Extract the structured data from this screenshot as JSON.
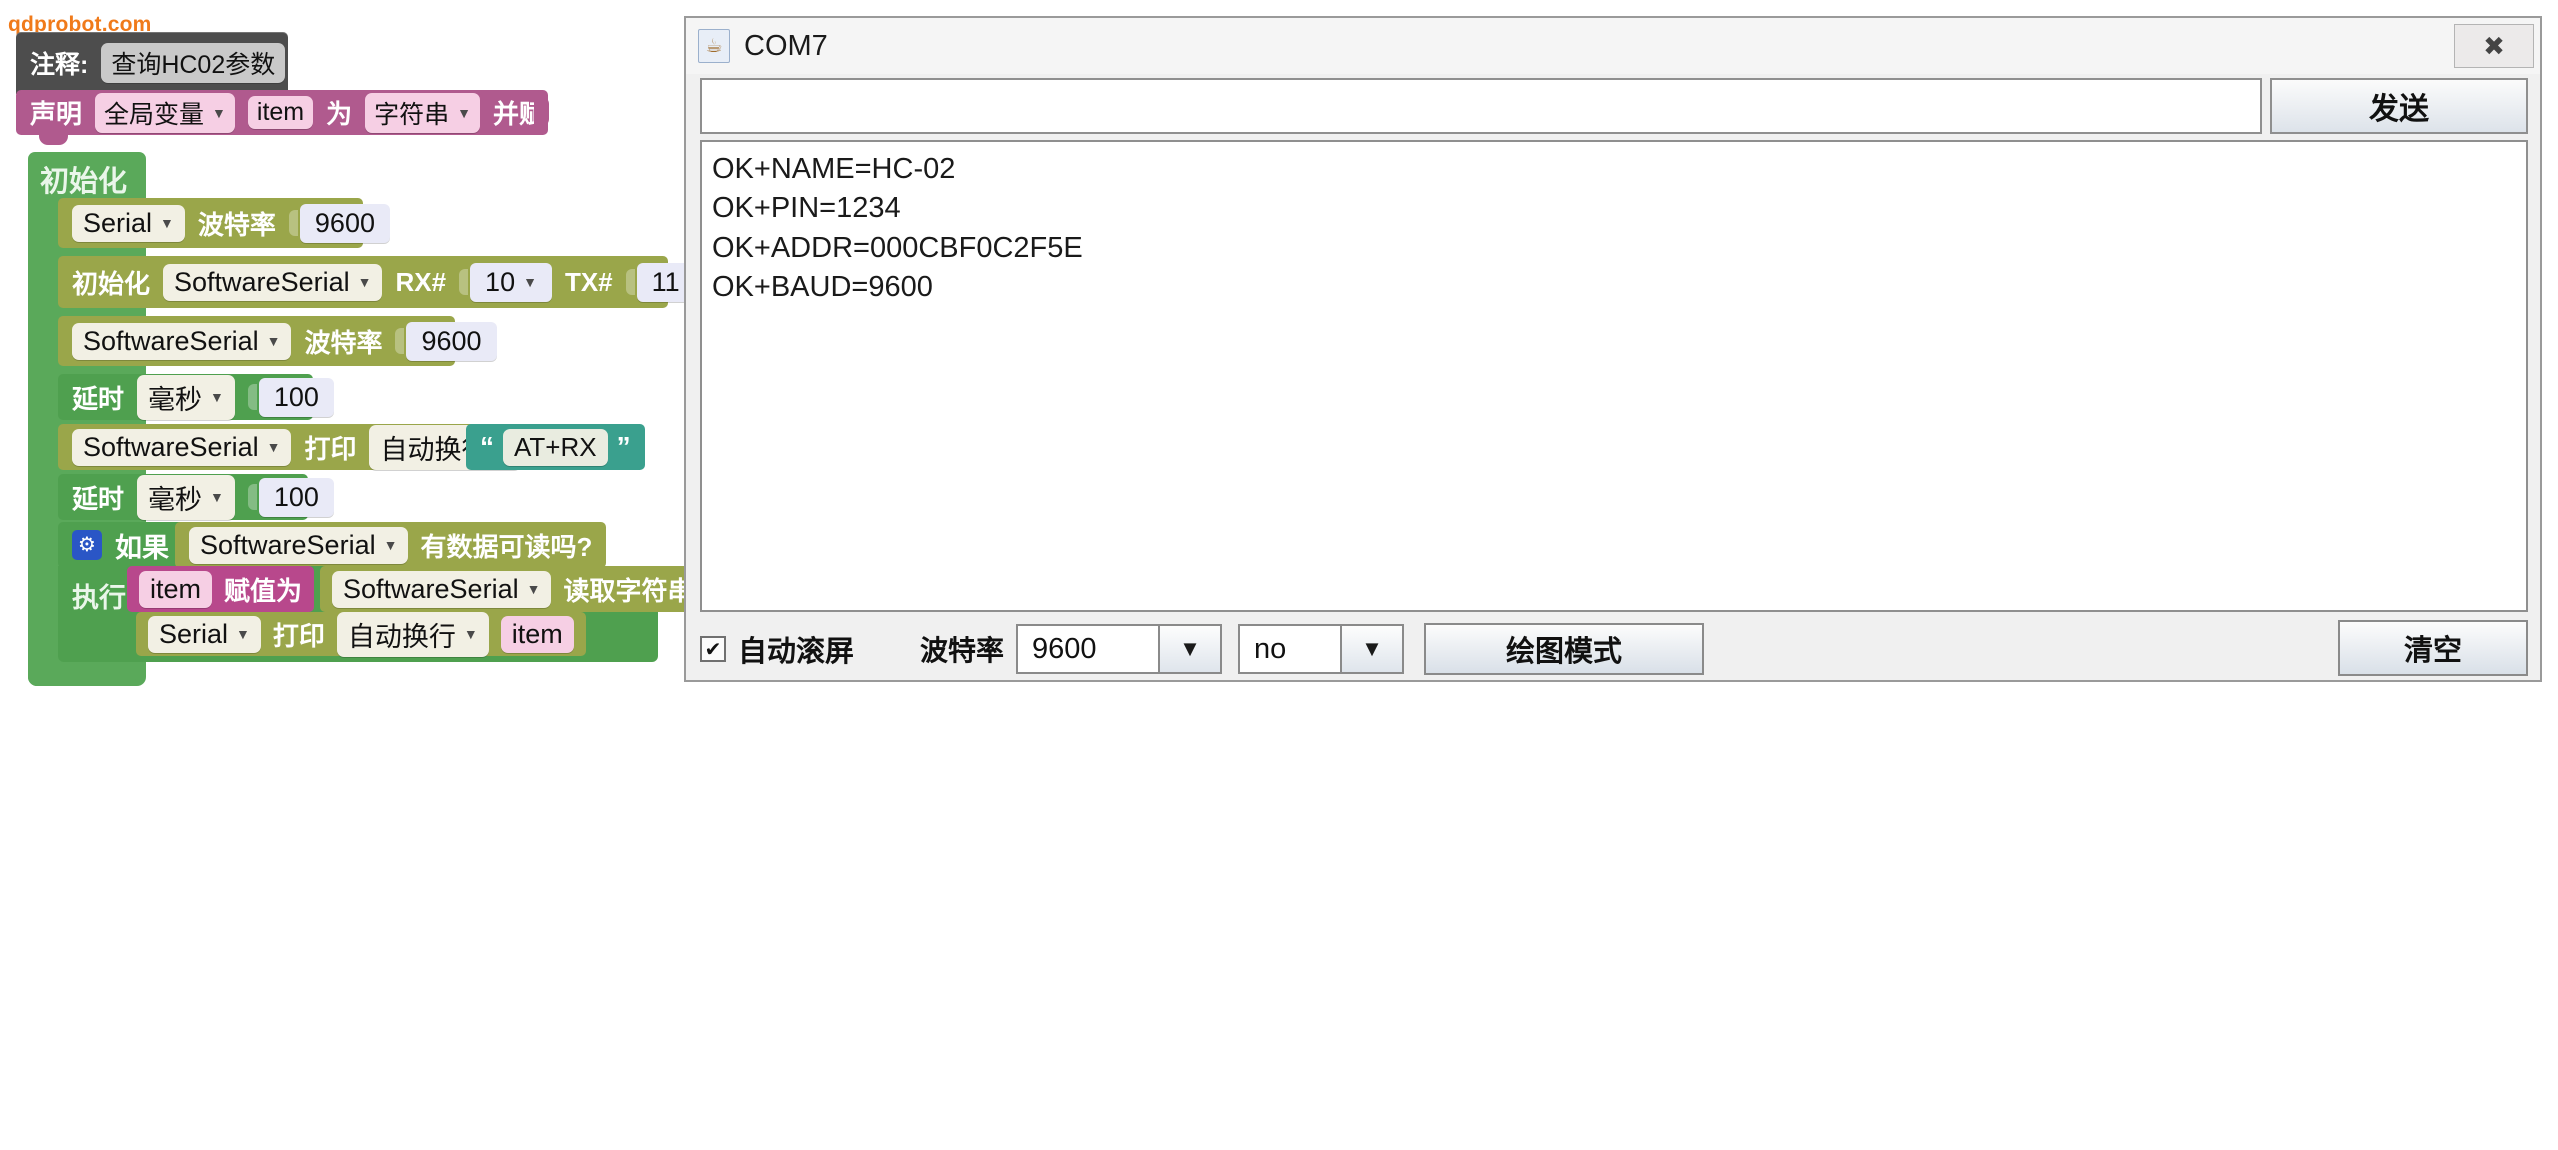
{
  "watermark": "qdprobot.com",
  "workspace": {
    "comment_block": {
      "label": "注释:",
      "value": "查询HC02参数"
    },
    "declare_block": {
      "keyword": "声明",
      "scope": "全局变量",
      "var_name": "item",
      "as_word": "为",
      "type": "字符串",
      "assign_word": "并赋值"
    },
    "setup_block": {
      "label": "初始化",
      "do_label": "执行",
      "rows": {
        "serial_baud": {
          "port": "Serial",
          "label": "波特率",
          "value": "9600"
        },
        "softserial_init": {
          "init_label": "初始化",
          "port": "SoftwareSerial",
          "rx_label": "RX#",
          "rx_pin": "10",
          "tx_label": "TX#",
          "tx_pin": "11"
        },
        "softserial_baud": {
          "port": "SoftwareSerial",
          "label": "波特率",
          "value": "9600"
        },
        "delay_1": {
          "label": "延时",
          "unit": "毫秒",
          "value": "100"
        },
        "softserial_print": {
          "port": "SoftwareSerial",
          "print_label": "打印",
          "newline_mode": "自动换行",
          "string_value": "AT+RX",
          "quote_open": "“",
          "quote_close": "”"
        },
        "delay_2": {
          "label": "延时",
          "unit": "毫秒",
          "value": "100"
        },
        "if_row": {
          "gear_icon": "gear-icon",
          "if_label": "如果",
          "port": "SoftwareSerial",
          "condition": "有数据可读吗?"
        },
        "assign_row": {
          "var_name": "item",
          "assign_label": "赋值为",
          "port": "SoftwareSerial",
          "action": "读取字符串"
        },
        "serial_print_row": {
          "port": "Serial",
          "print_label": "打印",
          "newline_mode": "自动换行",
          "var_name": "item"
        }
      }
    }
  },
  "monitor": {
    "title": "COM7",
    "icon": "java-icon",
    "close_label": "✖",
    "send_input_value": "",
    "send_button": "发送",
    "output_lines": [
      "OK+NAME=HC-02",
      "OK+PIN=1234",
      "OK+ADDR=000CBF0C2F5E",
      "OK+BAUD=9600"
    ],
    "autoscroll_label": "自动滚屏",
    "autoscroll_checked": "✔",
    "baud_label": "波特率",
    "baud_value": "9600",
    "line_ending_value": "no",
    "plot_button": "绘图模式",
    "clear_button": "清空",
    "dropdown_arrow": "▼"
  },
  "colors": {
    "comment": "#4d4d4d",
    "variable": "#b05a8e",
    "control": "#5aa95a",
    "serial": "#9aa64a",
    "time": "#4fa04f",
    "text_literal": "#3aa08e",
    "watermark": "#f07a1a"
  }
}
